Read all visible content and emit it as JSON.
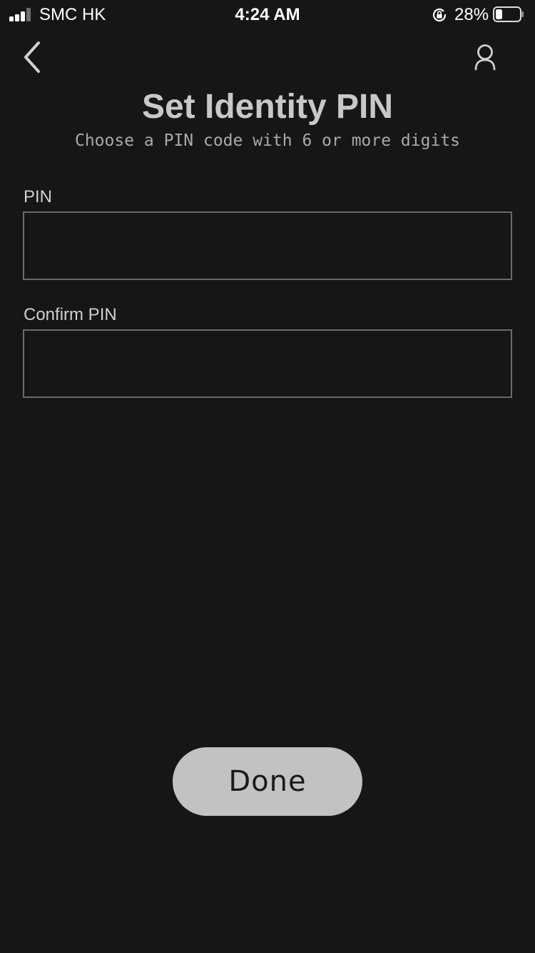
{
  "status_bar": {
    "carrier": "SMC HK",
    "time": "4:24 AM",
    "battery_percent_label": "28%",
    "battery_level": 0.28,
    "signal_bars_active": 3,
    "signal_bars_total": 4
  },
  "nav": {
    "back_icon": "chevron-left-icon",
    "profile_icon": "person-outline-icon"
  },
  "header": {
    "title": "Set Identity PIN",
    "subtitle": "Choose a PIN code with 6 or more digits"
  },
  "form": {
    "pin_label": "PIN",
    "pin_value": "",
    "confirm_label": "Confirm PIN",
    "confirm_value": ""
  },
  "actions": {
    "done_label": "Done"
  },
  "colors": {
    "background": "#161616",
    "text": "#cfcfcf",
    "input_border": "#6a6a6a",
    "button_bg": "#c2c2c2",
    "button_text": "#1a1a1a"
  }
}
